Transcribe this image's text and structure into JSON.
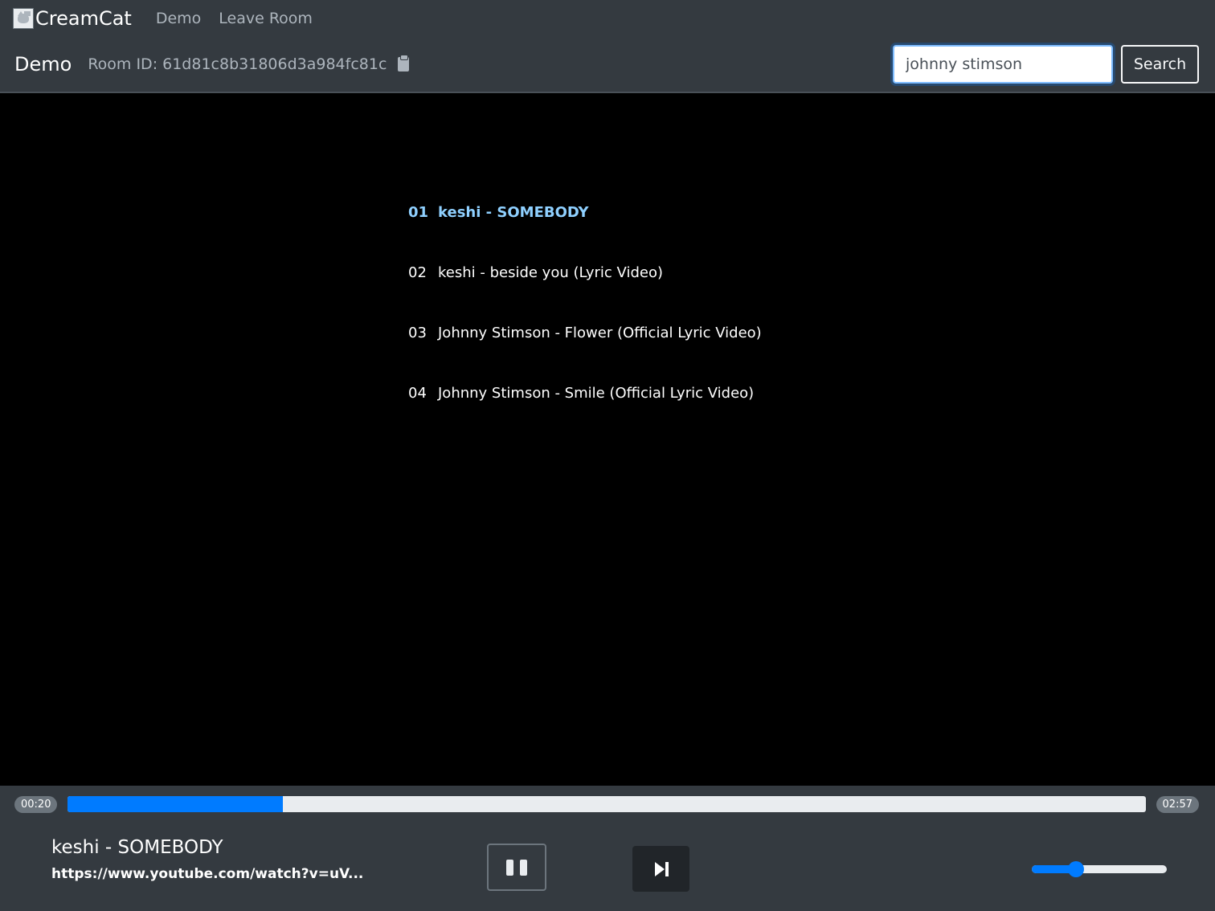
{
  "navbar": {
    "brand": "CreamCat",
    "links": [
      "Demo",
      "Leave Room"
    ]
  },
  "room": {
    "name": "Demo",
    "id_text": "Room ID: 61d81c8b31806d3a984fc81c"
  },
  "search": {
    "value": "johnny stimson",
    "button_label": "Search"
  },
  "playlist": [
    {
      "num": "01",
      "title": "keshi - SOMEBODY",
      "active": true
    },
    {
      "num": "02",
      "title": "keshi - beside you (Lyric Video)",
      "active": false
    },
    {
      "num": "03",
      "title": "Johnny Stimson - Flower (Official Lyric Video)",
      "active": false
    },
    {
      "num": "04",
      "title": "Johnny Stimson - Smile (Official Lyric Video)",
      "active": false
    }
  ],
  "player": {
    "elapsed": "00:20",
    "total": "02:57",
    "progress": 0.2,
    "title": "keshi - SOMEBODY",
    "url": "https://www.youtube.com/watch?v=uV...",
    "volume": 0.33
  },
  "colors": {
    "accent": "#007bff",
    "active_track": "#8fd0ff",
    "bar_bg": "#343a40"
  },
  "icons": {
    "brand_logo": "cat-logo-icon",
    "copy": "clipboard-icon",
    "pause": "pause-icon",
    "skip": "skip-next-icon"
  }
}
